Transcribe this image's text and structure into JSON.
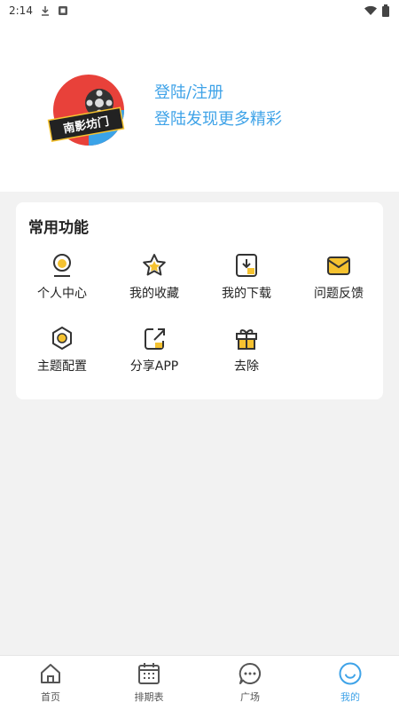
{
  "status_bar": {
    "time": "2:14",
    "icons": [
      "download-icon",
      "notification-icon",
      "wifi-icon",
      "battery-icon"
    ]
  },
  "profile": {
    "logo_text": "南影坊门",
    "login_title": "登陆/注册",
    "login_subtitle": "登陆发现更多精彩"
  },
  "features": {
    "title": "常用功能",
    "items": [
      {
        "label": "个人中心",
        "icon": "person-icon"
      },
      {
        "label": "我的收藏",
        "icon": "star-icon"
      },
      {
        "label": "我的下载",
        "icon": "download-box-icon"
      },
      {
        "label": "问题反馈",
        "icon": "mail-icon"
      },
      {
        "label": "主题配置",
        "icon": "theme-icon"
      },
      {
        "label": "分享APP",
        "icon": "share-icon"
      },
      {
        "label": "去除",
        "icon": "gift-icon"
      }
    ]
  },
  "tabbar": {
    "items": [
      {
        "label": "首页",
        "icon": "home-icon"
      },
      {
        "label": "排期表",
        "icon": "calendar-icon"
      },
      {
        "label": "广场",
        "icon": "chat-icon"
      },
      {
        "label": "我的",
        "icon": "smile-icon",
        "active": true
      }
    ]
  },
  "colors": {
    "accent": "#3fa3e8",
    "icon_yellow": "#f5c230",
    "logo_red": "#e8413a"
  }
}
